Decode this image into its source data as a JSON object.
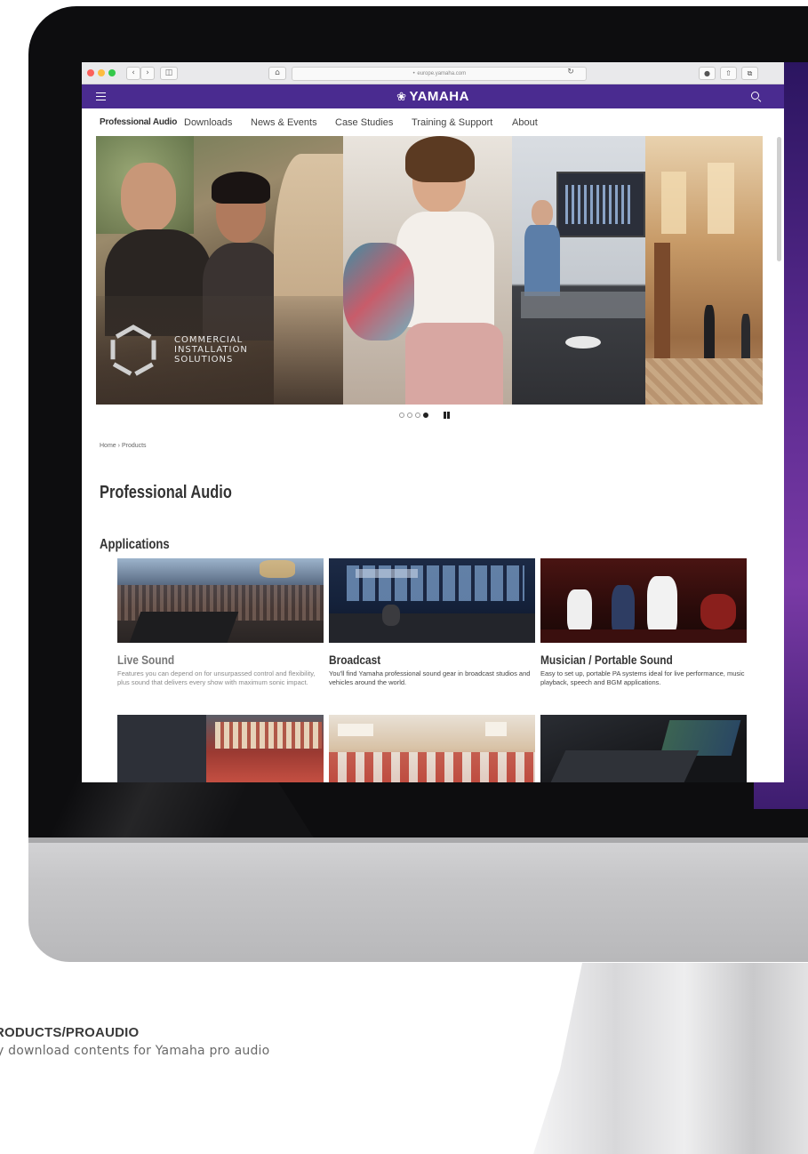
{
  "browser": {
    "url": "europe.yamaha.com"
  },
  "site": {
    "logo": "YAMAHA",
    "logo_mark": "❀"
  },
  "subnav": {
    "items": [
      "Professional Audio",
      "Downloads",
      "News & Events",
      "Case Studies",
      "Training & Support",
      "About"
    ]
  },
  "hero": {
    "caption": "COMMERCIAL\nINSTALLATION\nSOLUTIONS",
    "carousel_dots": 4,
    "active_dot": 4
  },
  "breadcrumb": {
    "home": "Home",
    "separator": "›",
    "current": "Products"
  },
  "page": {
    "title": "Professional Audio",
    "section": "Applications"
  },
  "cards": [
    {
      "title": "Live Sound",
      "description": "Features you can depend on for unsurpassed control and flexibility, plus sound that delivers every show with maximum sonic impact."
    },
    {
      "title": "Broadcast",
      "description": "You'll find Yamaha professional sound gear in broadcast studios and vehicles around the world."
    },
    {
      "title": "Musician / Portable Sound",
      "description": "Easy to set up, portable PA systems ideal for live performance, music playback, speech and BGM applications."
    }
  ],
  "caption": {
    "title": "RODUCTS/PROAUDIO",
    "description": "y download contents for Yamaha pro audio"
  },
  "colors": {
    "brand_purple": "#4a2b90",
    "bezel": "#0d0d0f"
  }
}
